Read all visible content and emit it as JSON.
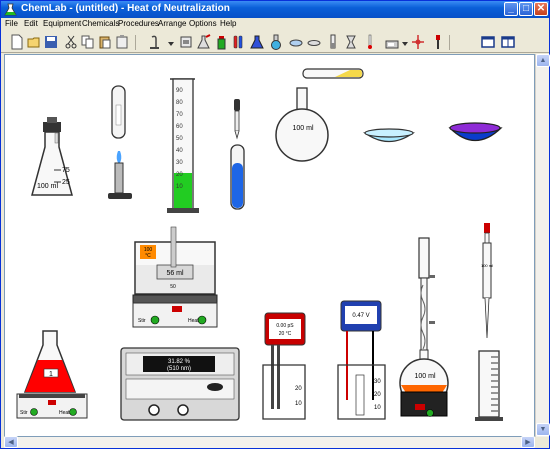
{
  "window": {
    "title": "ChemLab - (untitled) - Heat of Neutralization",
    "minimize": "_",
    "maximize": "□",
    "close": "✕"
  },
  "menu": [
    "File",
    "Edit",
    "Equipment",
    "Chemicals",
    "Procedures",
    "Arrange",
    "Options",
    "Help"
  ],
  "toolbar": {
    "icons": [
      "new-file-icon",
      "open-folder-icon",
      "save-icon",
      "cut-icon",
      "copy-icon",
      "paste-icon",
      "clipboard-icon",
      "bunsen-icon",
      "burner-options-icon",
      "stand-icon",
      "flask-icon",
      "bottle-icon",
      "test-tubes-icon",
      "beaker-icon",
      "flask-round-icon",
      "bowl-icon",
      "dish-icon",
      "burette-icon",
      "thermometer-icon",
      "thermometer-red-icon",
      "balance-icon",
      "pipette-icon",
      "window-icon",
      "split-window-icon"
    ]
  },
  "apparatus": {
    "erlenmeyer_top": {
      "marks": [
        "75",
        "100 ml",
        "25"
      ]
    },
    "graduated_cylinder": {
      "marks": [
        "90",
        "80",
        "70",
        "60",
        "50",
        "40",
        "30",
        "20",
        "10"
      ]
    },
    "round_flask_top": {
      "label": "100 ml"
    },
    "calorimeter_beaker": {
      "temp": "100",
      "unit": "°C",
      "volume": "56 ml",
      "volume_unit": "50",
      "marks": [
        "100",
        "50"
      ]
    },
    "hotplate_labels": [
      "Stir",
      "Heat"
    ],
    "spectrometer": {
      "value": "31.82 %",
      "wavelength": "(510 nm)"
    },
    "ph_meter": {
      "value": "0.00 pS",
      "temp": "20 °C"
    },
    "voltmeter": {
      "value": "0.47 V"
    },
    "distillation_flask": {
      "label": "100 ml"
    },
    "erlenmeyer_red": {
      "label": "1"
    },
    "small_cylinder": {
      "marks": [
        "10",
        "9",
        "8",
        "7",
        "6",
        "5",
        "4",
        "3",
        "2",
        "1"
      ]
    },
    "beaker_marks": [
      "20",
      "10"
    ],
    "volt_beaker_marks": [
      "30",
      "20",
      "10"
    ],
    "test_tube_top_label": "100 ml"
  },
  "colors": {
    "green": "#00cc00",
    "blue": "#0055cc",
    "red": "#ff0000",
    "orange": "#ff6600",
    "purple": "#8e2bd6",
    "cyan": "#a8e8ff"
  }
}
